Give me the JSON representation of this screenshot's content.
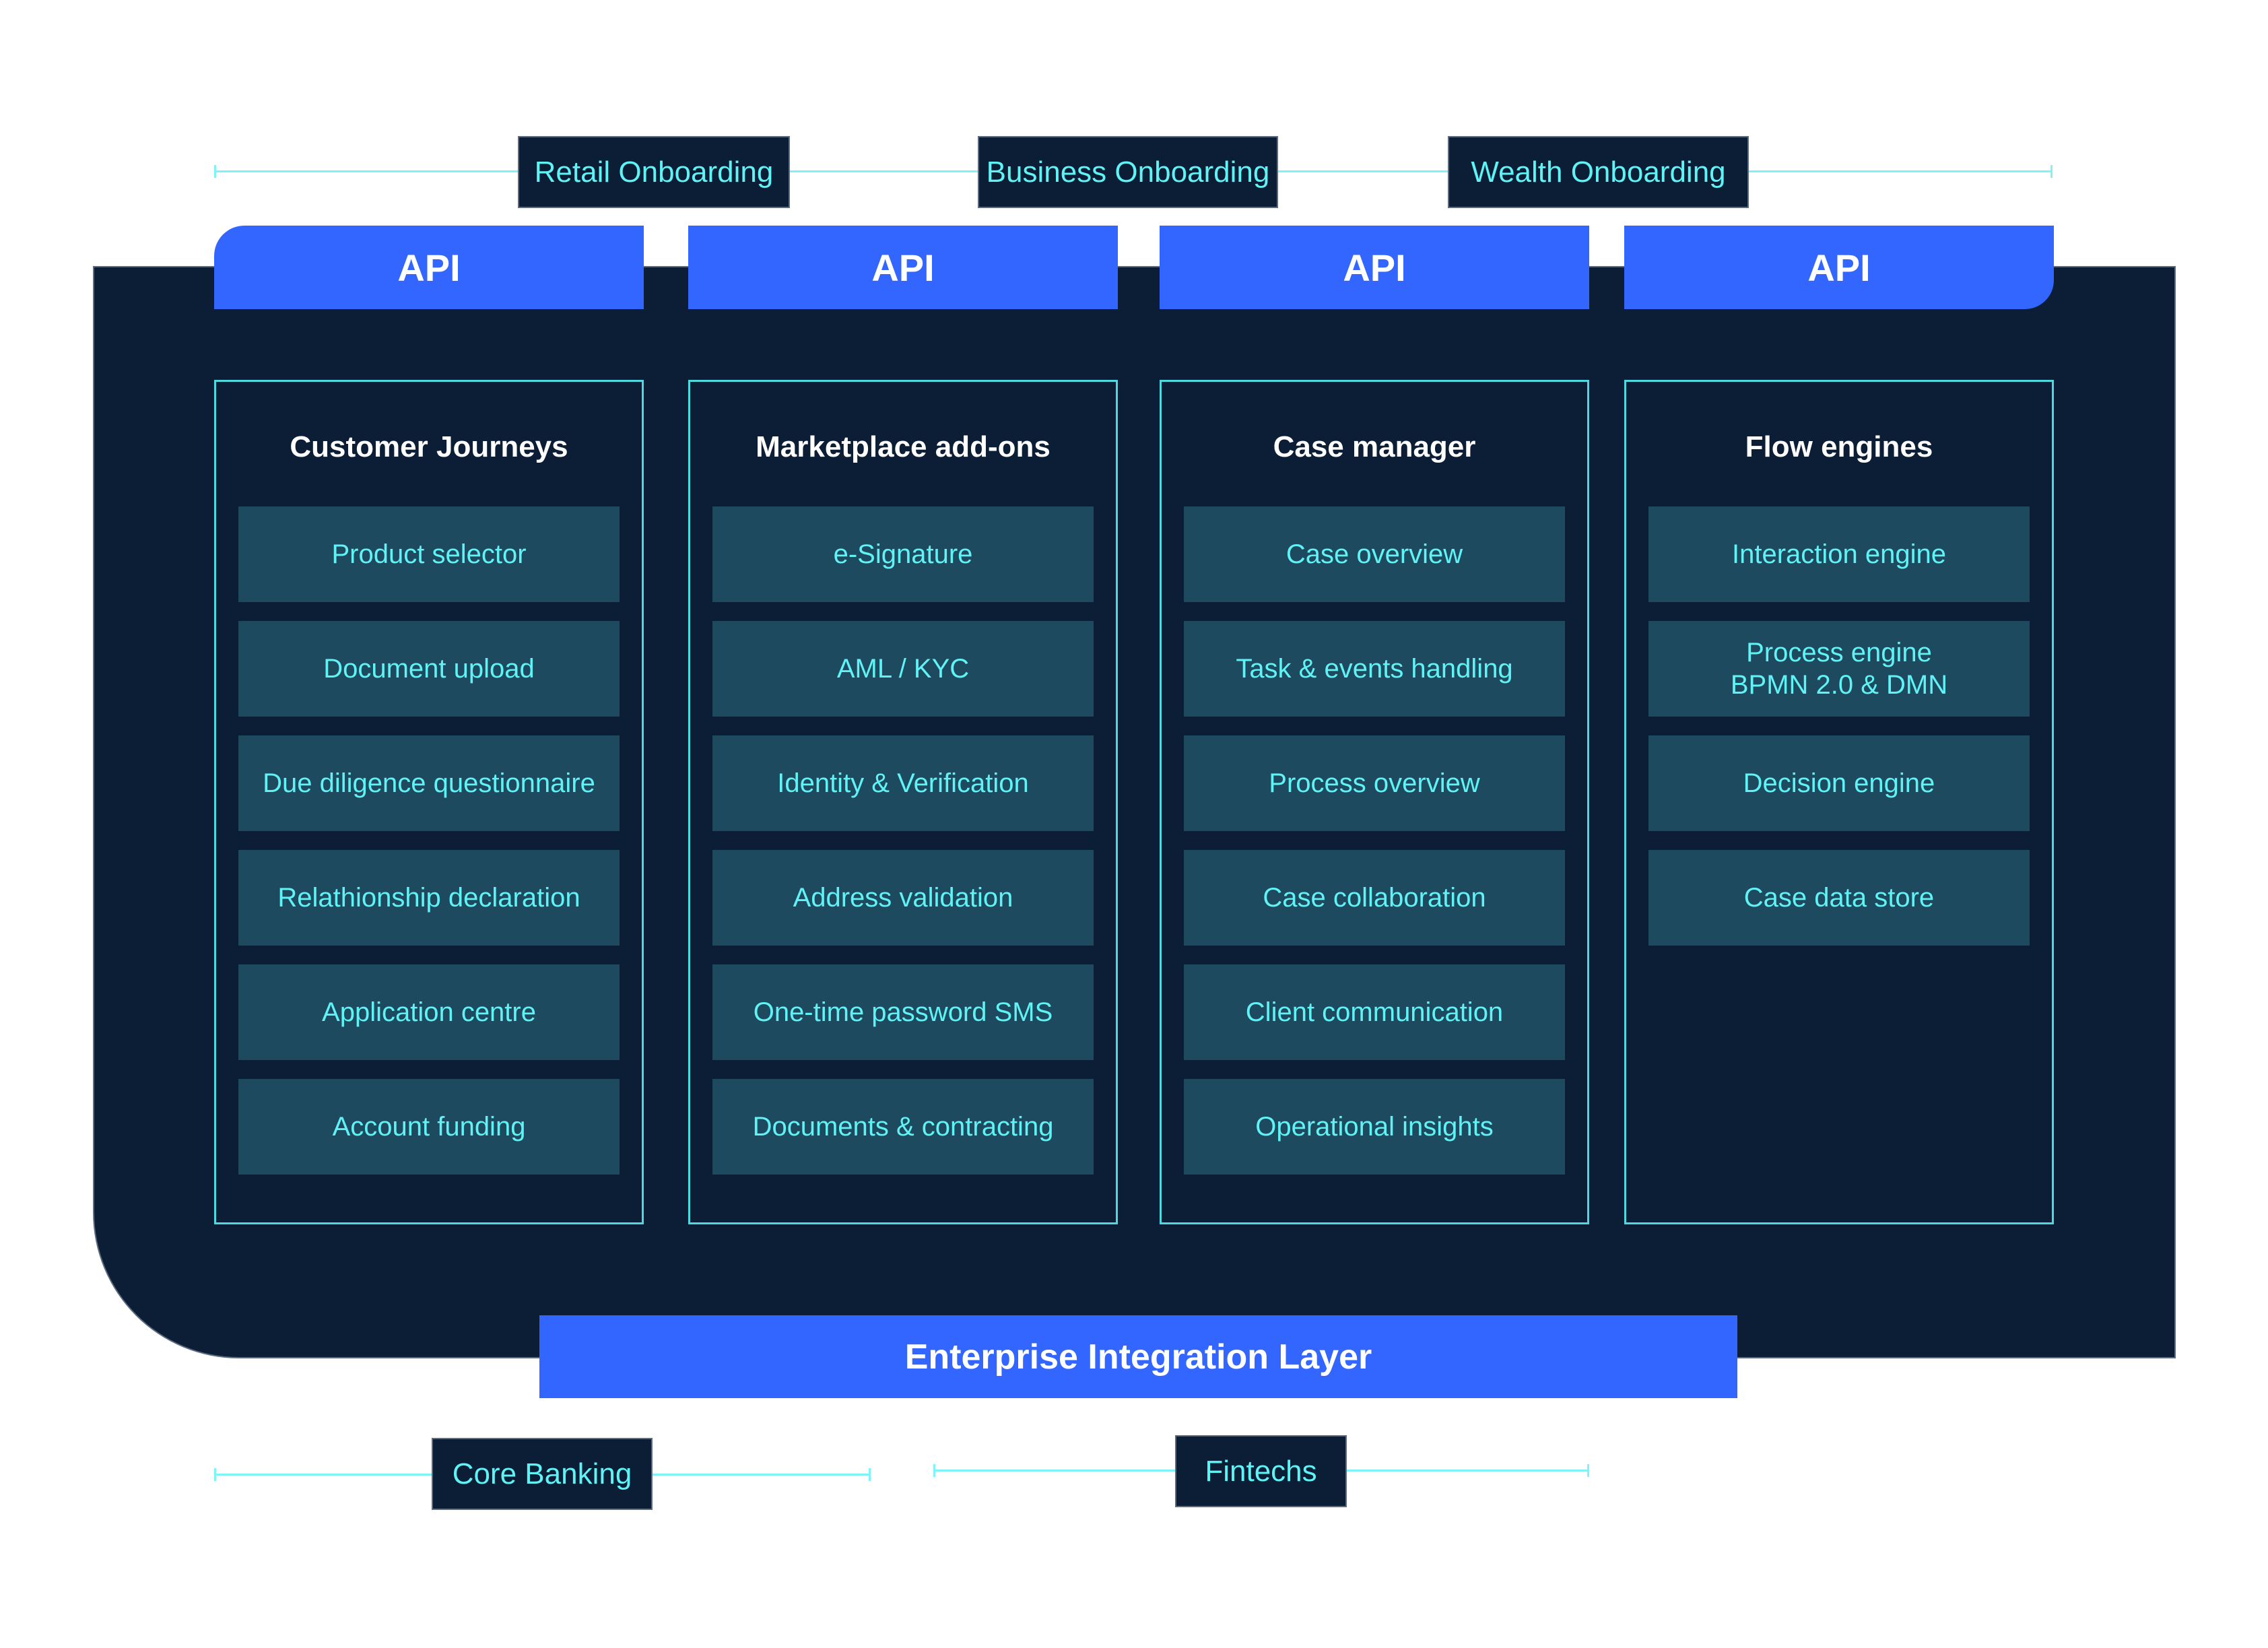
{
  "top_channels": [
    "Retail Onboarding",
    "Business Onboarding",
    "Wealth Onboarding"
  ],
  "api_label": "API",
  "columns": [
    {
      "title": "Customer Journeys",
      "items": [
        "Product selector",
        "Document upload",
        "Due diligence questionnaire",
        "Relathionship declaration",
        "Application centre",
        "Account funding"
      ]
    },
    {
      "title": "Marketplace add-ons",
      "items": [
        "e-Signature",
        "AML / KYC",
        "Identity & Verification",
        "Address validation",
        "One-time password SMS",
        "Documents & contracting"
      ]
    },
    {
      "title": "Case manager",
      "items": [
        "Case overview",
        "Task & events handling",
        "Process overview",
        "Case collaboration",
        "Client communication",
        "Operational insights"
      ]
    },
    {
      "title": "Flow engines",
      "items": [
        "Interaction engine",
        "Process engine\nBPMN 2.0 & DMN",
        "Decision engine",
        "Case data store"
      ]
    }
  ],
  "integration_layer": "Enterprise Integration Layer",
  "bottom_systems": [
    "Core Banking",
    "Fintechs"
  ],
  "colors": {
    "panel": "#0b1e36",
    "accent_blue": "#3366ff",
    "card": "#1e4a5f",
    "cyan_text": "#5ff3f5"
  }
}
